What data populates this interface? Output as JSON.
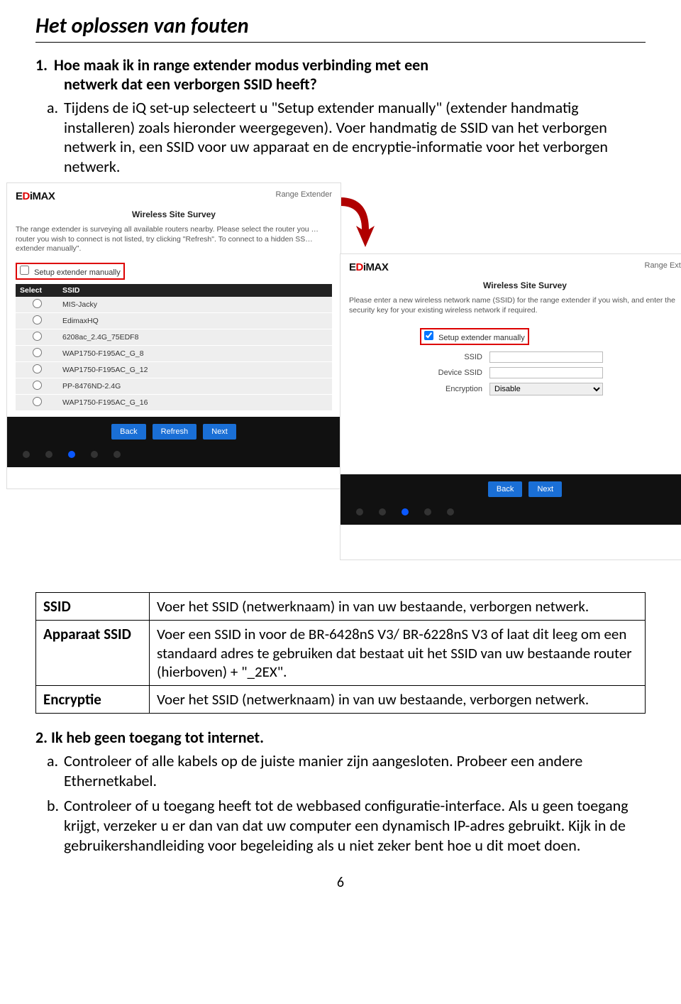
{
  "title": "Het oplossen van fouten",
  "q1": {
    "num": "1.",
    "heading_line1": "Hoe maak ik in range extender modus verbinding met een",
    "heading_line2": "netwerk dat een verborgen SSID heeft?",
    "a_letter": "a.",
    "a_text": "Tijdens de iQ set-up selecteert u \"Setup extender manually\" (extender handmatig installeren) zoals hieronder weergegeven). Voer handmatig de SSID van het verborgen netwerk in, een SSID voor uw apparaat en de encryptie-informatie voor het verborgen netwerk."
  },
  "screenshot1": {
    "logo_prefix": "E",
    "logo_red": "D",
    "logo_suffix": "iMAX",
    "range": "Range Extender",
    "survey": "Wireless Site Survey",
    "intro": "The range extender is surveying all available routers nearby. Please select the router you … router you wish to connect is not listed, try clicking \"Refresh\". To connect to a hidden SS… extender manually\".",
    "manual": "Setup extender manually",
    "col_select": "Select",
    "col_ssid": "SSID",
    "rows": [
      "MIS-Jacky",
      "EdimaxHQ",
      "6208ac_2.4G_75EDF8",
      "WAP1750-F195AC_G_8",
      "WAP1750-F195AC_G_12",
      "PP-8476ND-2.4G",
      "WAP1750-F195AC_G_16"
    ],
    "back": "Back",
    "refresh": "Refresh",
    "next": "Next"
  },
  "screenshot2": {
    "logo_prefix": "E",
    "logo_red": "D",
    "logo_suffix": "iMAX",
    "range": "Range Extender",
    "survey": "Wireless Site Survey",
    "intro": "Please enter a new wireless network name (SSID) for the range extender if you wish, and enter the security key for your existing wireless network if required.",
    "manual": "Setup extender manually",
    "lbl_ssid": "SSID",
    "lbl_devssid": "Device SSID",
    "lbl_enc": "Encryption",
    "enc_value": "Disable",
    "back": "Back",
    "next": "Next"
  },
  "def_table": {
    "r1k": "SSID",
    "r1v": "Voer het SSID (netwerknaam) in van uw bestaande, verborgen netwerk.",
    "r2k": "Apparaat SSID",
    "r2v": "Voer een SSID in voor de BR-6428nS V3/ BR-6228nS V3 of laat dit leeg om een standaard adres te gebruiken dat bestaat uit het SSID van uw bestaande router (hierboven) + \"_2EX\".",
    "r3k": "Encryptie",
    "r3v": "Voer het SSID (netwerknaam) in van uw bestaande, verborgen netwerk."
  },
  "q2": {
    "heading": "2. Ik heb geen toegang tot internet.",
    "a_letter": "a.",
    "a_text": "Controleer of alle kabels op de juiste manier zijn aangesloten. Probeer een andere Ethernetkabel.",
    "b_letter": "b.",
    "b_text": "Controleer of u toegang heeft tot de webbased configuratie-interface. Als u geen toegang krijgt, verzeker u er dan van dat uw computer een dynamisch IP-adres gebruikt. Kijk in de gebruikershandleiding voor begeleiding als u niet zeker bent hoe u dit moet doen."
  },
  "page_num": "6"
}
